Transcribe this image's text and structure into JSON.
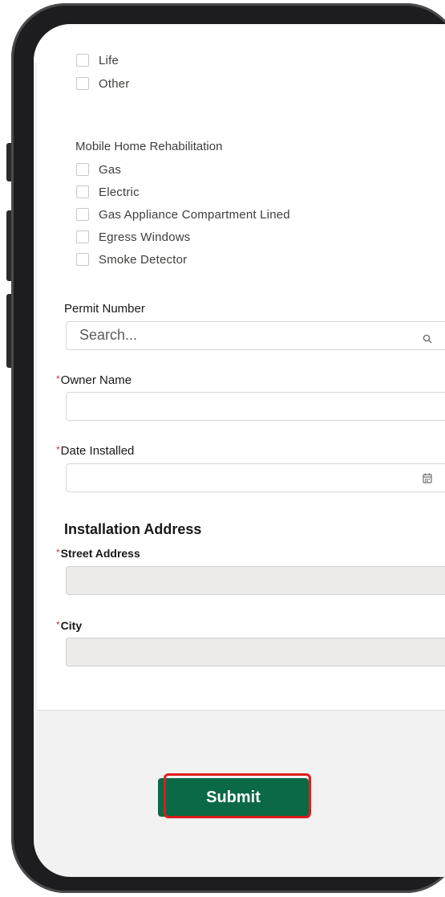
{
  "checkboxes_top": [
    {
      "label": "Life",
      "checked": false
    },
    {
      "label": "Other",
      "checked": false
    }
  ],
  "mobile_home": {
    "title": "Mobile Home Rehabilitation",
    "items": [
      {
        "label": "Gas",
        "checked": false
      },
      {
        "label": "Electric",
        "checked": false
      },
      {
        "label": "Gas Appliance Compartment Lined",
        "checked": false
      },
      {
        "label": "Egress Windows",
        "checked": false
      },
      {
        "label": "Smoke Detector",
        "checked": false
      }
    ]
  },
  "permit": {
    "label": "Permit Number",
    "placeholder": "Search...",
    "icon": "search-icon"
  },
  "owner": {
    "required_mark": "*",
    "label": "Owner Name",
    "value": ""
  },
  "date_installed": {
    "required_mark": "*",
    "label": "Date Installed",
    "value": "",
    "icon": "calendar-icon"
  },
  "installation_address": {
    "title": "Installation Address",
    "street": {
      "required_mark": "*",
      "label": "Street Address",
      "value": ""
    },
    "city": {
      "required_mark": "*",
      "label": "City",
      "value": ""
    }
  },
  "submit": {
    "label": "Submit"
  },
  "colors": {
    "submit_bg": "#0b6a45",
    "required": "#c23934",
    "highlight": "#e01b1b"
  }
}
